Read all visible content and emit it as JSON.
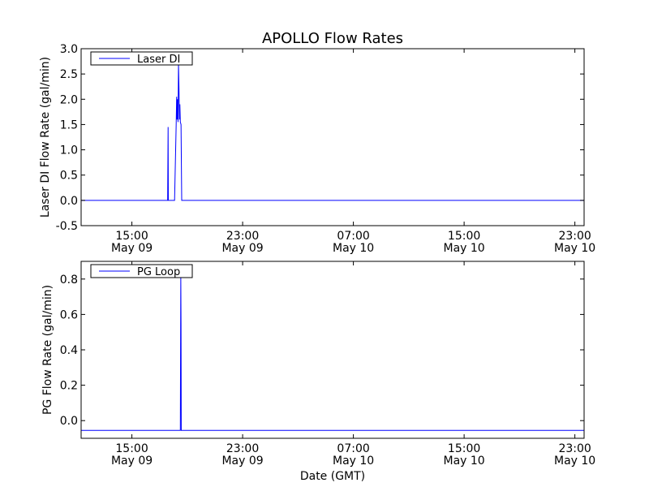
{
  "title": "APOLLO Flow Rates",
  "chart_data": [
    {
      "type": "line",
      "title": "APOLLO Flow Rates",
      "xlabel": "",
      "ylabel": "Laser DI Flow Rate (gal/min)",
      "xlim": [
        "2012-05-09 11:20",
        "2012-05-10 23:40"
      ],
      "ylim": [
        -0.5,
        3.0
      ],
      "yticks": [
        -0.5,
        0.0,
        0.5,
        1.0,
        1.5,
        2.0,
        2.5,
        3.0
      ],
      "ytick_labels": [
        "-0.5",
        "0.0",
        "0.5",
        "1.0",
        "1.5",
        "2.0",
        "2.5",
        "3.0"
      ],
      "xticks": [
        {
          "time": "2012-05-09 15:00",
          "line1": "15:00",
          "line2": "May 09"
        },
        {
          "time": "2012-05-09 23:00",
          "line1": "23:00",
          "line2": "May 09"
        },
        {
          "time": "2012-05-10 07:00",
          "line1": "07:00",
          "line2": "May 10"
        },
        {
          "time": "2012-05-10 15:00",
          "line1": "15:00",
          "line2": "May 10"
        },
        {
          "time": "2012-05-10 23:00",
          "line1": "23:00",
          "line2": "May 10"
        }
      ],
      "grid": false,
      "legend_position": "top-left",
      "series": [
        {
          "name": "Laser DI",
          "color": "#0000ff",
          "points": [
            [
              "2012-05-09 11:20",
              0.0
            ],
            [
              "2012-05-09 17:35",
              0.0
            ],
            [
              "2012-05-09 17:37",
              1.45
            ],
            [
              "2012-05-09 17:38",
              0.0
            ],
            [
              "2012-05-09 18:05",
              0.0
            ],
            [
              "2012-05-09 18:12",
              1.5
            ],
            [
              "2012-05-09 18:14",
              2.05
            ],
            [
              "2012-05-09 18:16",
              1.6
            ],
            [
              "2012-05-09 18:18",
              2.0
            ],
            [
              "2012-05-09 18:20",
              1.55
            ],
            [
              "2012-05-09 18:22",
              2.7
            ],
            [
              "2012-05-09 18:24",
              2.25
            ],
            [
              "2012-05-09 18:26",
              1.6
            ],
            [
              "2012-05-09 18:28",
              1.9
            ],
            [
              "2012-05-09 18:30",
              1.55
            ],
            [
              "2012-05-09 18:33",
              1.5
            ],
            [
              "2012-05-09 18:36",
              0.0
            ],
            [
              "2012-05-10 23:40",
              0.0
            ]
          ]
        }
      ]
    },
    {
      "type": "line",
      "xlabel": "Date (GMT)",
      "ylabel": "PG Flow Rate (gal/min)",
      "xlim": [
        "2012-05-09 11:20",
        "2012-05-10 23:40"
      ],
      "ylim": [
        -0.1,
        0.9
      ],
      "yticks": [
        0.0,
        0.2,
        0.4,
        0.6,
        0.8
      ],
      "ytick_labels": [
        "0.0",
        "0.2",
        "0.4",
        "0.6",
        "0.8"
      ],
      "xticks": [
        {
          "time": "2012-05-09 15:00",
          "line1": "15:00",
          "line2": "May 09"
        },
        {
          "time": "2012-05-09 23:00",
          "line1": "23:00",
          "line2": "May 09"
        },
        {
          "time": "2012-05-10 07:00",
          "line1": "07:00",
          "line2": "May 10"
        },
        {
          "time": "2012-05-10 15:00",
          "line1": "15:00",
          "line2": "May 10"
        },
        {
          "time": "2012-05-10 23:00",
          "line1": "23:00",
          "line2": "May 10"
        }
      ],
      "grid": false,
      "legend_position": "top-left",
      "series": [
        {
          "name": "PG Loop",
          "color": "#0000ff",
          "points": [
            [
              "2012-05-09 11:20",
              -0.055
            ],
            [
              "2012-05-09 18:30",
              -0.055
            ],
            [
              "2012-05-09 18:32",
              0.82
            ],
            [
              "2012-05-09 18:33",
              0.55
            ],
            [
              "2012-05-09 18:34",
              -0.055
            ],
            [
              "2012-05-10 23:40",
              -0.055
            ]
          ]
        }
      ]
    }
  ]
}
